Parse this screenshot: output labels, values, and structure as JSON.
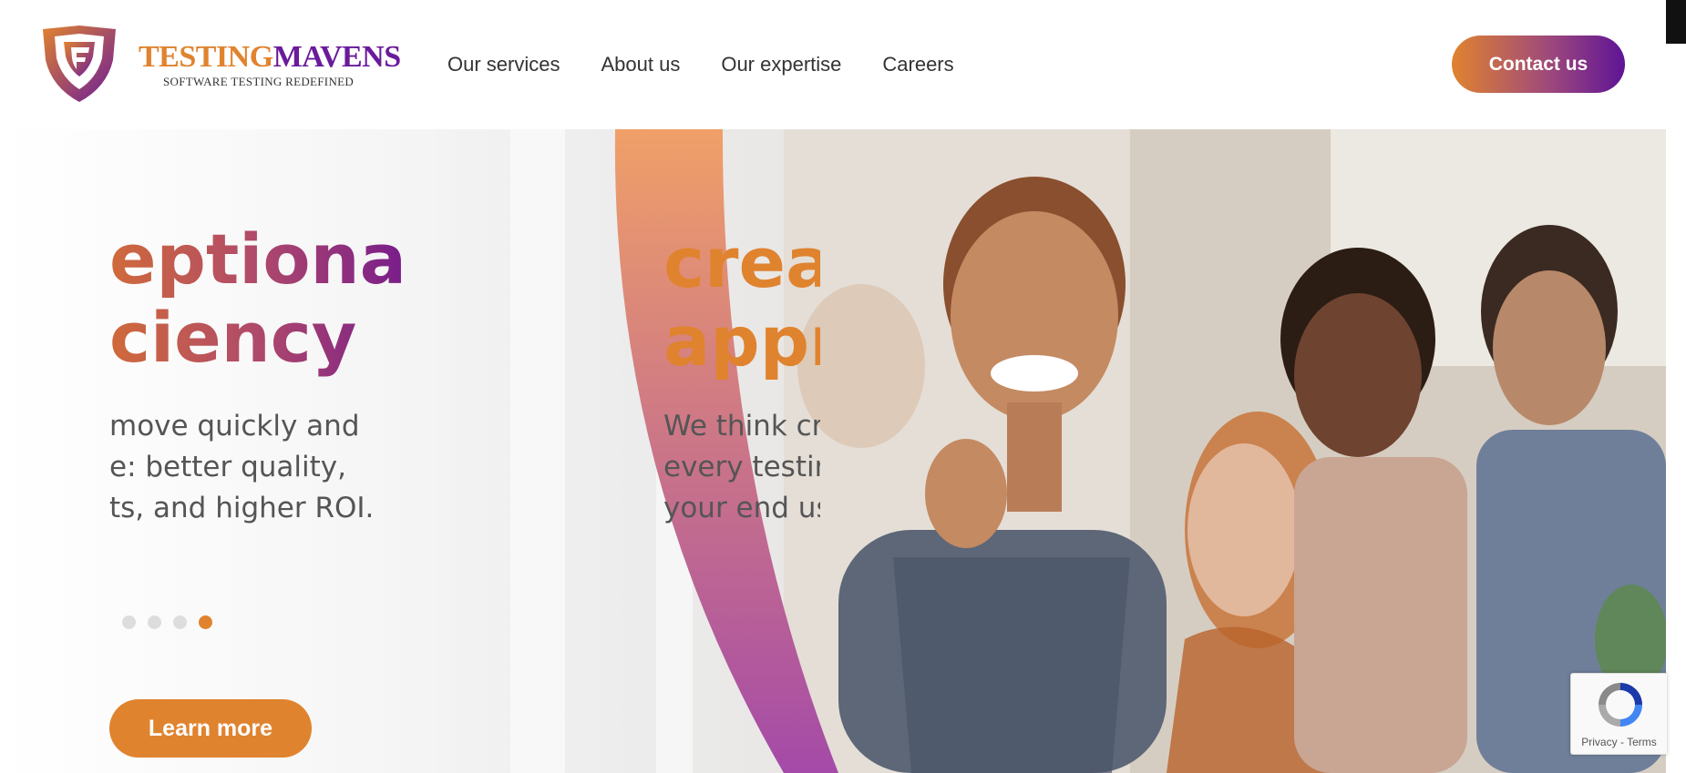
{
  "brand": {
    "word1": "TESTING",
    "word2": "MAVENS",
    "tagline": "SOFTWARE TESTING REDEFINED",
    "icon": "shield-logo-icon"
  },
  "nav": {
    "items": [
      {
        "label": "Our services"
      },
      {
        "label": "About us"
      },
      {
        "label": "Our expertise"
      },
      {
        "label": "Careers"
      }
    ],
    "contact_label": "Contact us"
  },
  "hero": {
    "slide_left": {
      "title_line1": "eptional",
      "title_line2": "ciency",
      "body_lines": [
        "move quickly and",
        "e: better quality,",
        "ts, and higher ROI."
      ]
    },
    "slide_right": {
      "title_line1": "crea",
      "title_line2": "appr",
      "body_lines": [
        "We think cre",
        "every testing",
        "your end us"
      ]
    },
    "dots": {
      "count": 4,
      "active_index": 3
    },
    "learn_more_label": "Learn more"
  },
  "recaptcha": {
    "privacy": "Privacy",
    "separator": " - ",
    "terms": "Terms"
  },
  "colors": {
    "orange": "#e0832f",
    "purple": "#5e1496",
    "text": "#333333"
  }
}
